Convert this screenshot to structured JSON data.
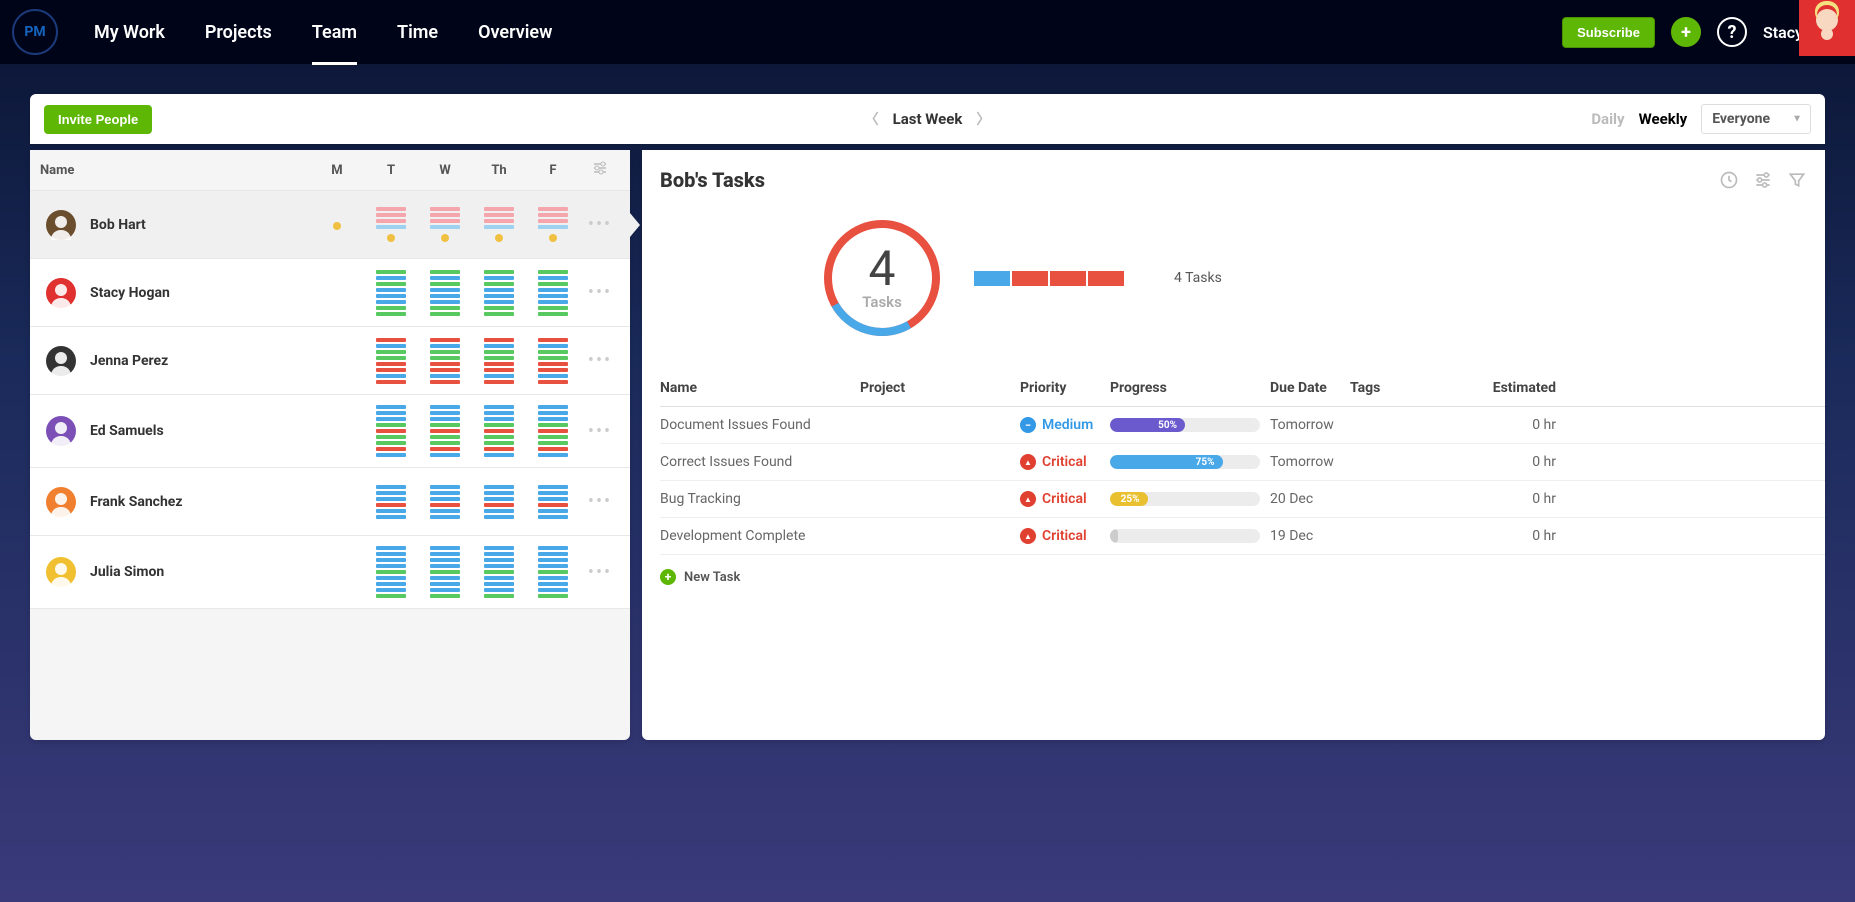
{
  "nav": {
    "logo_text": "PM",
    "tabs": [
      "My Work",
      "Projects",
      "Team",
      "Time",
      "Overview"
    ],
    "active_tab": 2,
    "subscribe": "Subscribe",
    "user_name": "Stacy"
  },
  "toolbar": {
    "invite": "Invite People",
    "week_label": "Last Week",
    "view_daily": "Daily",
    "view_weekly": "Weekly",
    "filter_value": "Everyone"
  },
  "team_header": {
    "name_col": "Name",
    "days": [
      "M",
      "T",
      "W",
      "Th",
      "F"
    ]
  },
  "colors": {
    "pink": "#f4a6ac",
    "blue": "#49a8e8",
    "lblue": "#9ed0f0",
    "green": "#58c860",
    "red": "#e85040",
    "orange": "#f0a030",
    "yellow": "#f0c040"
  },
  "people": [
    {
      "name": "Bob Hart",
      "avatar_bg": "#6b4e2e",
      "selected": true,
      "days": [
        {
          "bars": [],
          "dot": true
        },
        {
          "bars": [
            "pink",
            "pink",
            "pink",
            "lblue"
          ],
          "dot": true
        },
        {
          "bars": [
            "pink",
            "pink",
            "pink",
            "lblue"
          ],
          "dot": true
        },
        {
          "bars": [
            "pink",
            "pink",
            "pink",
            "lblue"
          ],
          "dot": true
        },
        {
          "bars": [
            "pink",
            "pink",
            "pink",
            "lblue"
          ],
          "dot": true
        }
      ]
    },
    {
      "name": "Stacy Hogan",
      "avatar_bg": "#e03030",
      "selected": false,
      "days": [
        {
          "bars": []
        },
        {
          "bars": [
            "green",
            "blue",
            "green",
            "blue",
            "blue",
            "blue",
            "green",
            "green"
          ]
        },
        {
          "bars": [
            "green",
            "blue",
            "green",
            "blue",
            "blue",
            "blue",
            "green",
            "green"
          ]
        },
        {
          "bars": [
            "green",
            "blue",
            "green",
            "blue",
            "blue",
            "blue",
            "green",
            "green"
          ]
        },
        {
          "bars": [
            "green",
            "blue",
            "green",
            "blue",
            "blue",
            "blue",
            "green",
            "green"
          ]
        }
      ]
    },
    {
      "name": "Jenna Perez",
      "avatar_bg": "#333",
      "selected": false,
      "days": [
        {
          "bars": []
        },
        {
          "bars": [
            "red",
            "blue",
            "green",
            "green",
            "red",
            "red",
            "blue",
            "red"
          ]
        },
        {
          "bars": [
            "red",
            "blue",
            "green",
            "green",
            "red",
            "red",
            "blue",
            "red"
          ]
        },
        {
          "bars": [
            "red",
            "blue",
            "green",
            "green",
            "red",
            "red",
            "blue",
            "red"
          ]
        },
        {
          "bars": [
            "red",
            "blue",
            "green",
            "green",
            "red",
            "red",
            "blue",
            "red"
          ]
        }
      ]
    },
    {
      "name": "Ed Samuels",
      "avatar_bg": "#7b4fb5",
      "selected": false,
      "days": [
        {
          "bars": []
        },
        {
          "bars": [
            "blue",
            "blue",
            "blue",
            "green",
            "red",
            "green",
            "green",
            "red",
            "blue"
          ]
        },
        {
          "bars": [
            "blue",
            "blue",
            "blue",
            "green",
            "red",
            "green",
            "green",
            "red",
            "blue"
          ]
        },
        {
          "bars": [
            "blue",
            "blue",
            "blue",
            "green",
            "red",
            "green",
            "green",
            "red",
            "blue"
          ]
        },
        {
          "bars": [
            "blue",
            "blue",
            "blue",
            "green",
            "red",
            "green",
            "green",
            "red",
            "blue"
          ]
        }
      ]
    },
    {
      "name": "Frank Sanchez",
      "avatar_bg": "#f08030",
      "selected": false,
      "days": [
        {
          "bars": []
        },
        {
          "bars": [
            "blue",
            "blue",
            "blue",
            "red",
            "blue",
            "blue"
          ]
        },
        {
          "bars": [
            "blue",
            "blue",
            "blue",
            "red",
            "blue",
            "blue"
          ]
        },
        {
          "bars": [
            "blue",
            "blue",
            "blue",
            "red",
            "blue",
            "blue"
          ]
        },
        {
          "bars": [
            "blue",
            "blue",
            "blue",
            "red",
            "blue",
            "blue"
          ]
        }
      ]
    },
    {
      "name": "Julia Simon",
      "avatar_bg": "#f0c030",
      "selected": false,
      "days": [
        {
          "bars": []
        },
        {
          "bars": [
            "blue",
            "blue",
            "blue",
            "blue",
            "green",
            "blue",
            "blue",
            "blue",
            "green"
          ]
        },
        {
          "bars": [
            "blue",
            "blue",
            "blue",
            "blue",
            "green",
            "blue",
            "blue",
            "blue",
            "green"
          ]
        },
        {
          "bars": [
            "blue",
            "blue",
            "blue",
            "blue",
            "green",
            "blue",
            "blue",
            "blue",
            "green"
          ]
        },
        {
          "bars": [
            "blue",
            "blue",
            "blue",
            "blue",
            "green",
            "blue",
            "blue",
            "blue",
            "green"
          ]
        }
      ]
    }
  ],
  "detail": {
    "title": "Bob's Tasks",
    "donut": {
      "number": "4",
      "label": "Tasks",
      "blue_pct": 25
    },
    "stack": [
      "#49a8e8",
      "#e85040",
      "#e85040",
      "#e85040"
    ],
    "tasks_count_label": "4 Tasks",
    "columns": [
      "Name",
      "Project",
      "Priority",
      "Progress",
      "Due Date",
      "Tags",
      "Estimated"
    ],
    "tasks": [
      {
        "name": "Document Issues Found",
        "project": "",
        "priority": "Medium",
        "progress": 50,
        "progress_color": "#6a5acd",
        "due": "Tomorrow",
        "est": "0 hr"
      },
      {
        "name": "Correct Issues Found",
        "project": "",
        "priority": "Critical",
        "progress": 75,
        "progress_color": "#49a8e8",
        "due": "Tomorrow",
        "est": "0 hr"
      },
      {
        "name": "Bug Tracking",
        "project": "",
        "priority": "Critical",
        "progress": 25,
        "progress_color": "#e8c030",
        "due": "20 Dec",
        "est": "0 hr"
      },
      {
        "name": "Development Complete",
        "project": "",
        "priority": "Critical",
        "progress": 0,
        "progress_color": "#ccc",
        "due": "19 Dec",
        "est": "0 hr"
      }
    ],
    "new_task": "New Task"
  },
  "chart_data": {
    "type": "pie",
    "title": "Bob's Tasks",
    "categories": [
      "Medium",
      "Critical"
    ],
    "values": [
      1,
      3
    ],
    "total": 4,
    "colors": {
      "Medium": "#49a8e8",
      "Critical": "#e85040"
    }
  }
}
